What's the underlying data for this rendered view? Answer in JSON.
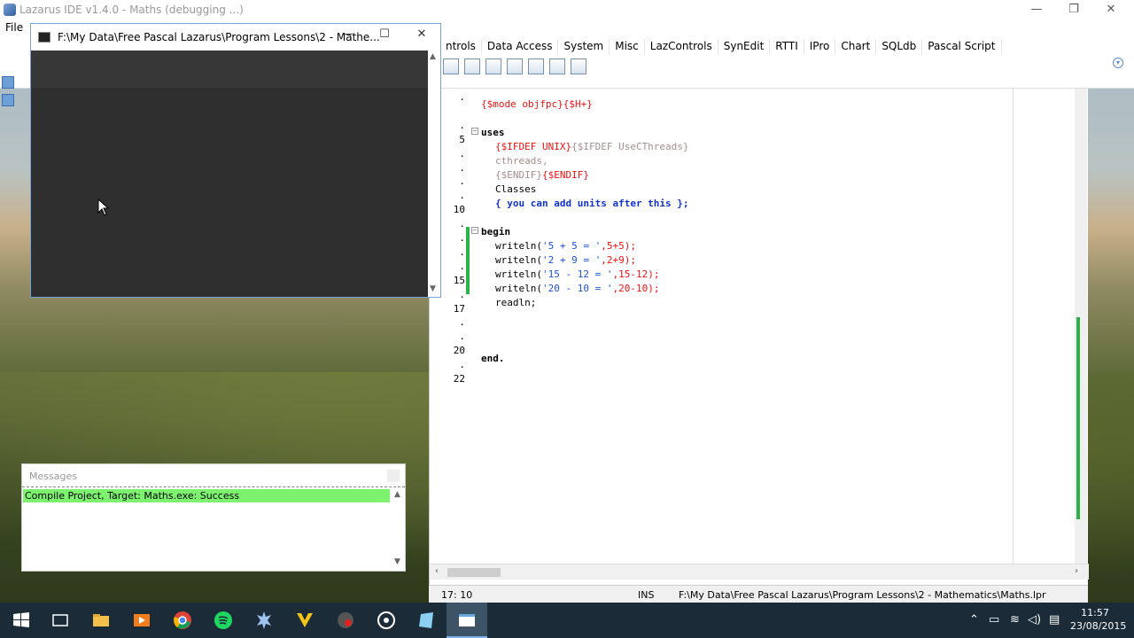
{
  "ide": {
    "title": "Lazarus IDE v1.4.0 - Maths (debugging ...)",
    "menu_file": "File",
    "palette_tabs": [
      "ntrols",
      "Data Access",
      "System",
      "Misc",
      "LazControls",
      "SynEdit",
      "RTTI",
      "IPro",
      "Chart",
      "SQLdb",
      "Pascal Script"
    ]
  },
  "console": {
    "title": "F:\\My Data\\Free Pascal Lazarus\\Program Lessons\\2 - Mathe..."
  },
  "editor": {
    "line_numbers": [
      {
        "text": ".",
        "row": 0
      },
      {
        "text": ".",
        "row": 2
      },
      {
        "text": "5",
        "row": 3
      },
      {
        "text": ".",
        "row": 4
      },
      {
        "text": ".",
        "row": 5
      },
      {
        "text": ".",
        "row": 6
      },
      {
        "text": ".",
        "row": 7
      },
      {
        "text": "10",
        "row": 8
      },
      {
        "text": ".",
        "row": 9
      },
      {
        "text": ".",
        "row": 10
      },
      {
        "text": ".",
        "row": 11
      },
      {
        "text": ".",
        "row": 12
      },
      {
        "text": "15",
        "row": 13
      },
      {
        "text": ".",
        "row": 14
      },
      {
        "text": "17",
        "row": 15
      },
      {
        "text": ".",
        "row": 16
      },
      {
        "text": ".",
        "row": 17
      },
      {
        "text": "20",
        "row": 18
      },
      {
        "text": ".",
        "row": 19
      },
      {
        "text": "22",
        "row": 20
      }
    ],
    "code": {
      "mode_directive": "{$mode objfpc}{$H+}",
      "uses": "uses",
      "ifdef_unix": "{$IFDEF UNIX}",
      "ifdef_cthreads": "{$IFDEF UseCThreads}",
      "cthreads": "cthreads,",
      "endif_gray": "{$ENDIF}",
      "endif_red": "{$ENDIF}",
      "classes": "Classes",
      "comment": "{ you can add units after this };",
      "begin": "begin",
      "writeln_kw": "writeln(",
      "line1_str": "'5 + 5 = '",
      "line1_rest": ",5+5);",
      "line2_str": "'2 + 9 = '",
      "line2_rest": ",2+9);",
      "line3_str": "'15 - 12 = '",
      "line3_rest": ",15-12);",
      "line4_str": "'20 - 10 = '",
      "line4_rest": ",20-10);",
      "readln": "readln;",
      "end": "end."
    }
  },
  "status": {
    "position": "17: 10",
    "mode": "INS",
    "path": "F:\\My Data\\Free Pascal Lazarus\\Program Lessons\\2 - Mathematics\\Maths.lpr"
  },
  "messages": {
    "title": "Messages",
    "line": "Compile Project, Target: Maths.exe: Success"
  },
  "taskbar": {
    "time": "11:57",
    "date": "23/08/2015"
  }
}
